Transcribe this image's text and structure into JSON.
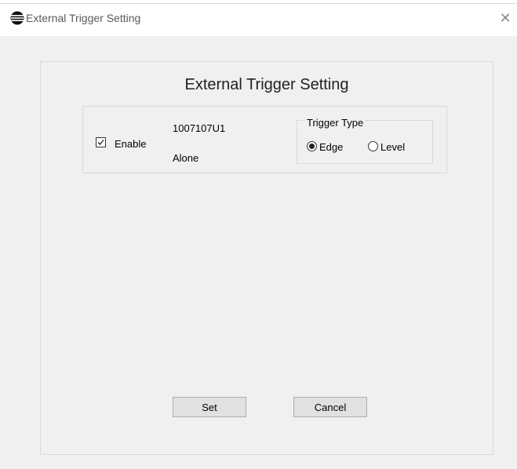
{
  "window": {
    "title": "External Trigger Setting",
    "close_glyph": "✕",
    "icon": "app-logo-icon"
  },
  "dialog": {
    "heading": "External Trigger Setting",
    "device": {
      "enable_label": "Enable",
      "enable_checked": true,
      "serial": "1007107U1",
      "mode": "Alone"
    },
    "trigger_type": {
      "legend": "Trigger Type",
      "options": [
        {
          "label": "Edge",
          "selected": true
        },
        {
          "label": "Level",
          "selected": false
        }
      ]
    },
    "buttons": {
      "set": "Set",
      "cancel": "Cancel"
    }
  }
}
